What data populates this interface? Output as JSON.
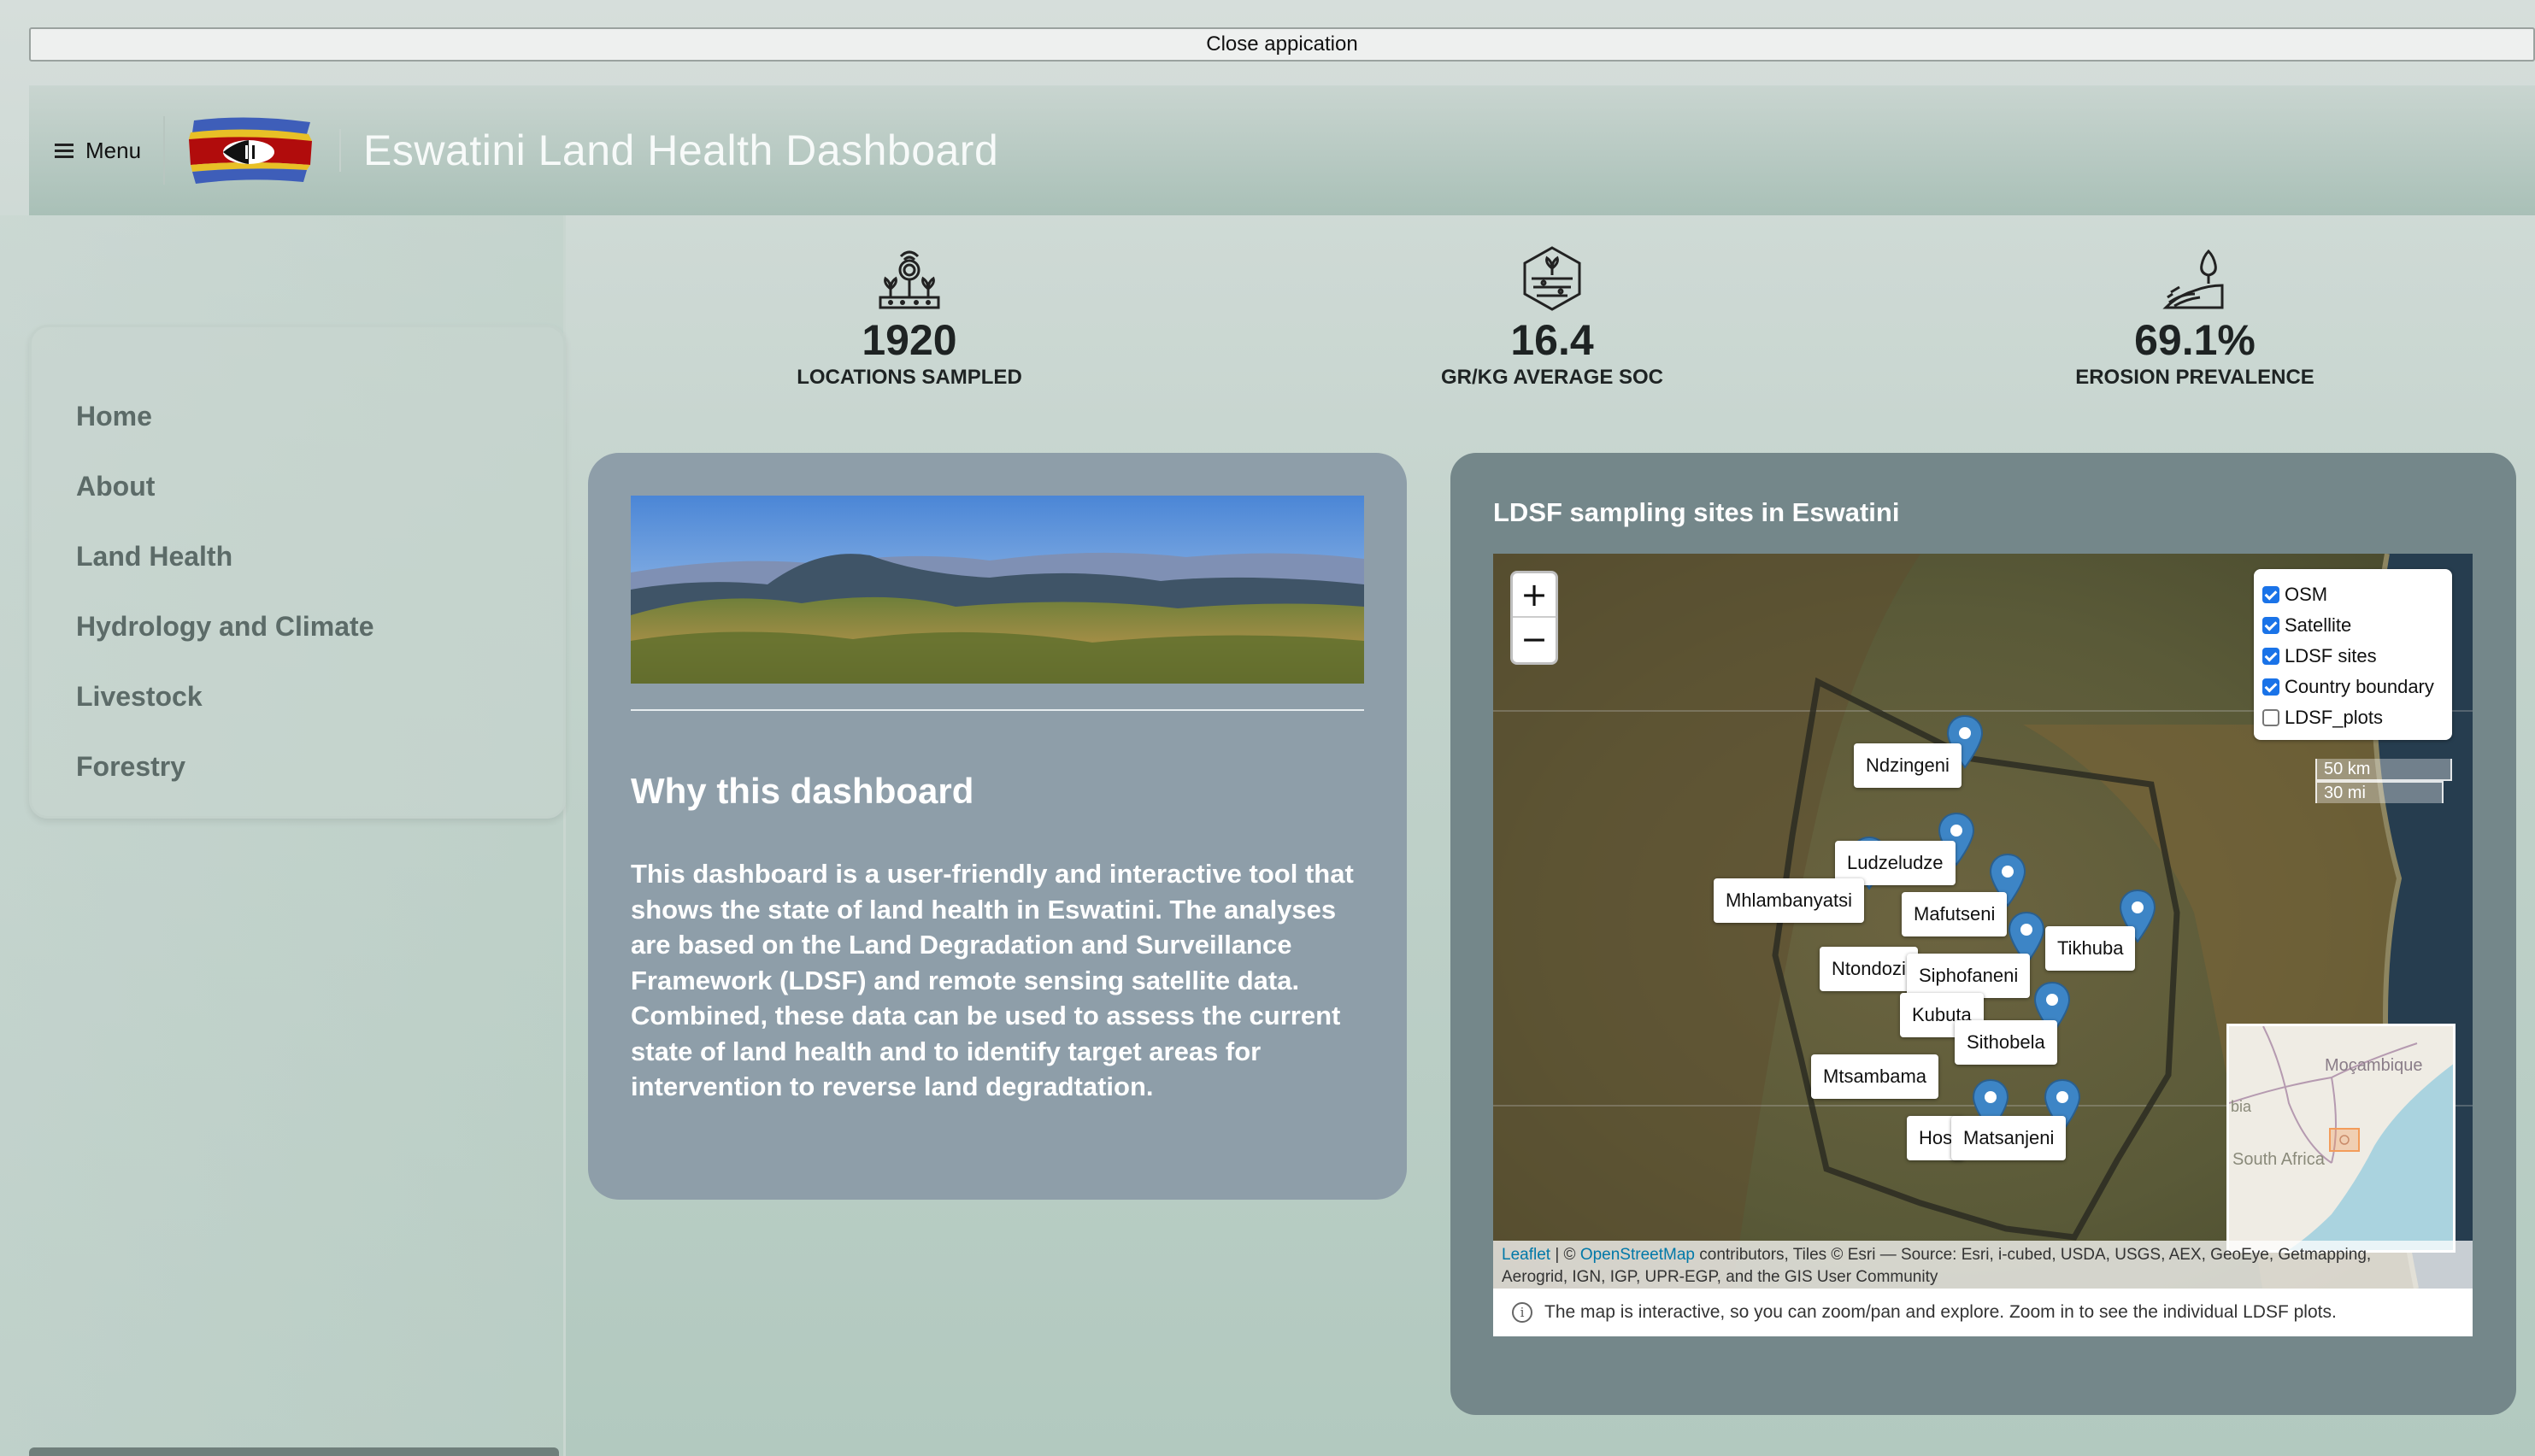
{
  "close_bar": {
    "label": "Close appication"
  },
  "header": {
    "menu_label": "Menu",
    "title": "Eswatini Land Health Dashboard"
  },
  "sidebar": {
    "items": [
      {
        "label": "Home"
      },
      {
        "label": "About"
      },
      {
        "label": "Land Health"
      },
      {
        "label": "Hydrology and Climate"
      },
      {
        "label": "Livestock"
      },
      {
        "label": "Forestry"
      }
    ]
  },
  "stats": [
    {
      "value": "1920",
      "label": "LOCATIONS SAMPLED",
      "icon": "sensor-plants-icon"
    },
    {
      "value": "16.4",
      "label": "GR/KG AVERAGE SOC",
      "icon": "soil-hexagon-icon"
    },
    {
      "value": "69.1%",
      "label": "EROSION PREVALENCE",
      "icon": "erosion-tree-icon"
    }
  ],
  "why": {
    "title": "Why this dashboard",
    "text": "This dashboard is a user-friendly and interactive tool that shows the state of land health in Eswatini. The analyses are based on the Land Degradation and Surveillance Framework (LDSF) and remote sensing satellite data. Combined, these data can be used to assess the current state of land health and to identify target areas for intervention to reverse land degradtation."
  },
  "map": {
    "title": "LDSF sampling sites in Eswatini",
    "zoom_in": "+",
    "zoom_out": "−",
    "layers": [
      {
        "label": "OSM",
        "checked": true
      },
      {
        "label": "Satellite",
        "checked": true
      },
      {
        "label": "LDSF sites",
        "checked": true
      },
      {
        "label": "Country boundary",
        "checked": true
      },
      {
        "label": "LDSF_plots",
        "checked": false
      }
    ],
    "scale_km": "50 km",
    "scale_mi": "30 mi",
    "minimap": {
      "label_mozambique": "Moçambique",
      "label_south_africa": "South Africa",
      "label_bia": "bia"
    },
    "sites": [
      "Ndzingeni",
      "Ludzeludze",
      "Mhlambanyatsi",
      "Mafutseni",
      "Tikhuba",
      "Ntondozi",
      "Siphofaneni",
      "Kubuta",
      "Sithobela",
      "Mtsambama",
      "Hos",
      "Matsanjeni"
    ],
    "attribution": {
      "leaflet": "Leaflet",
      "sep": " | © ",
      "osm": "OpenStreetMap",
      "rest1": " contributors, Tiles © Esri — Source: Esri, i-cubed, USDA, USGS, AEX, GeoEye, Getmapping,",
      "rest2": "Aerogrid, IGN, IGP, UPR-EGP, and the GIS User Community"
    },
    "note": "The map is interactive, so you can zoom/pan and explore. Zoom in to see the individual LDSF plots."
  },
  "colors": {
    "accent_marker": "#3d85c6",
    "card_why": "#8e9ea9",
    "card_map": "#74878a"
  }
}
